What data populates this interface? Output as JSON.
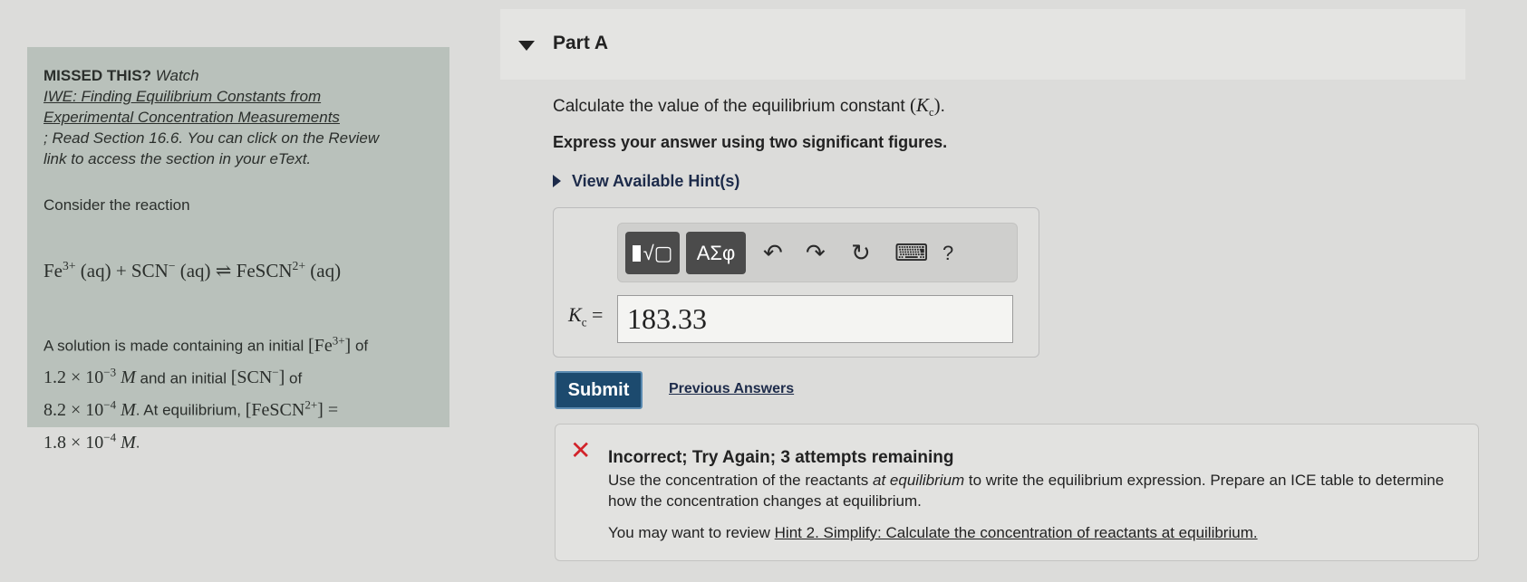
{
  "sidebar": {
    "missed_bold": "MISSED THIS?",
    "missed_watch": "Watch",
    "iwe_link": "IWE: Finding Equilibrium Constants from Experimental Concentration Measurements",
    "read_text": "; Read Section 16.6. You can click on the Review link to access the section in your eText.",
    "consider": "Consider the reaction",
    "reaction": "Fe3+ (aq) + SCN− (aq) ⇌ FeSCN2+ (aq)",
    "solution_intro": "A solution is made containing an initial",
    "fe_conc": "1.2 × 10−3 M",
    "scn_conc": "8.2 × 10−4 M",
    "feSCN_conc": "1.8 × 10−4 M"
  },
  "part": {
    "title": "Part A",
    "question": "Calculate the value of the equilibrium constant",
    "express": "Express your answer using two significant figures.",
    "hints_label": "View Available Hint(s)"
  },
  "toolbar": {
    "template_label": "√▢",
    "greek_label": "ΑΣφ",
    "undo_glyph": "↶",
    "redo_glyph": "↷",
    "reset_glyph": "↻",
    "keyboard_glyph": "⌨",
    "help_glyph": "?"
  },
  "answer": {
    "label": "Kc =",
    "value": "183.33"
  },
  "actions": {
    "submit": "Submit",
    "previous": "Previous Answers"
  },
  "feedback": {
    "title": "Incorrect; Try Again; 3 attempts remaining",
    "body_pre": "Use the concentration of the reactants",
    "body_em": "at equilibrium",
    "body_post": "to write the equilibrium expression. Prepare an ICE table to determine how the concentration changes at equilibrium.",
    "review_pre": "You may want to review",
    "review_link": "Hint 2. Simplify: Calculate the concentration of reactants at equilibrium."
  },
  "colors": {
    "accent_submit": "#1c4a6e",
    "error_red": "#d2232a",
    "sidebar_bg": "#b9c1bb"
  }
}
